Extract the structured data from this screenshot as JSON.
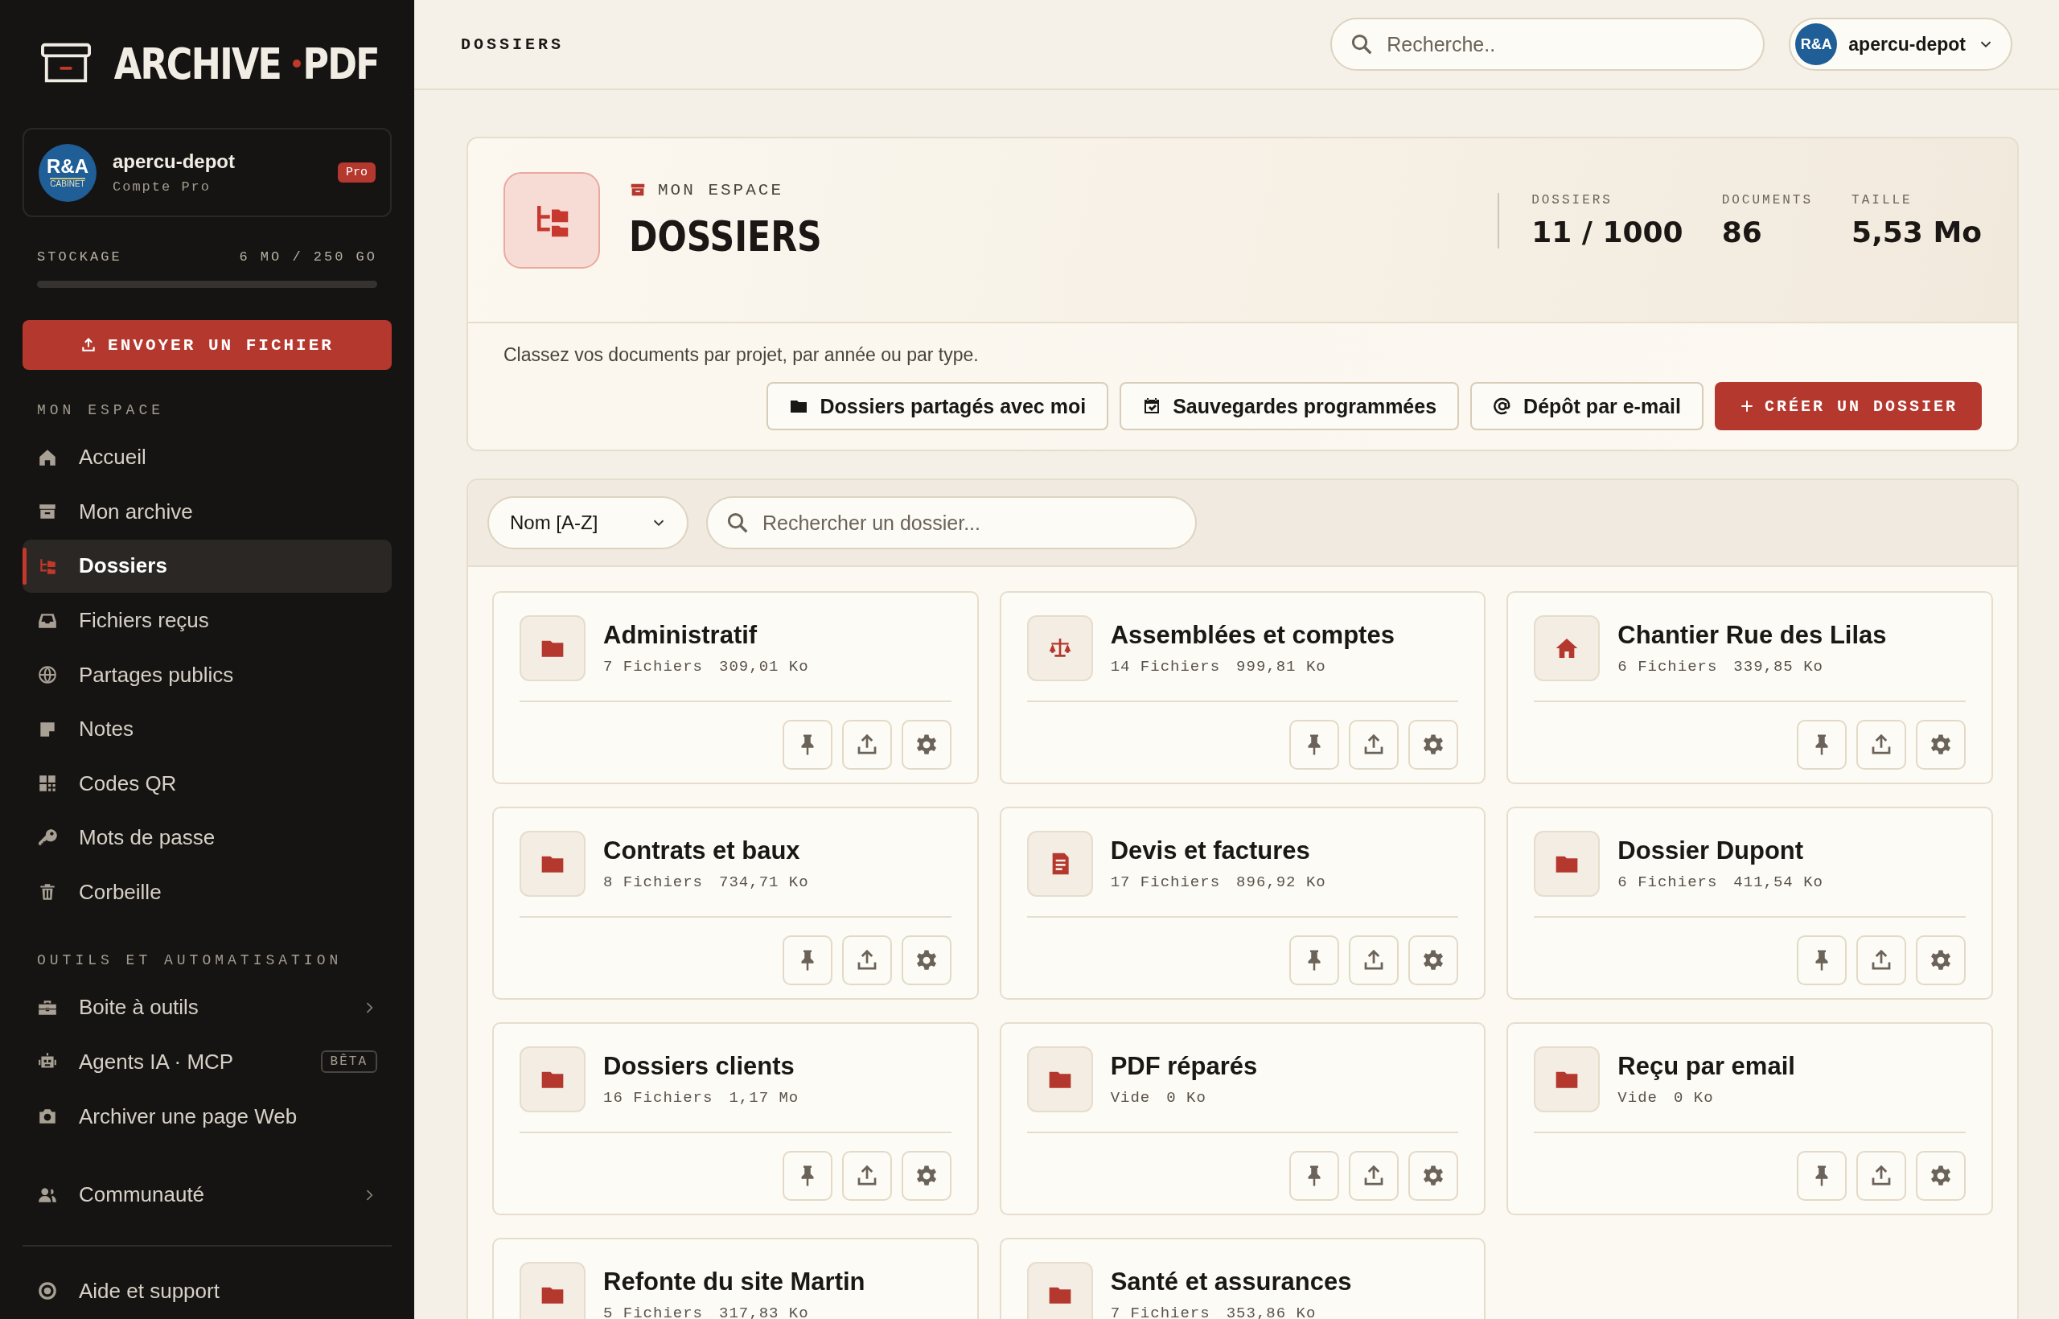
{
  "logo": {
    "left": "ARCHIVE",
    "right": "PDF"
  },
  "account": {
    "avatar": "R&A",
    "avatar_sub": "CABINET",
    "name": "apercu-depot",
    "plan": "Compte Pro",
    "badge": "Pro"
  },
  "storage": {
    "label": "STOCKAGE",
    "reading": "6 MO / 250 GO",
    "level": 0.0
  },
  "upload_button": "ENVOYER UN FICHIER",
  "nav_sections": [
    {
      "title": "MON ESPACE",
      "items": [
        {
          "label": "Accueil",
          "selected": false,
          "has_submenu": false
        },
        {
          "label": "Mon archive",
          "selected": false,
          "has_submenu": false
        },
        {
          "label": "Dossiers",
          "selected": true,
          "has_submenu": false
        },
        {
          "label": "Fichiers reçus",
          "selected": false,
          "has_submenu": false
        },
        {
          "label": "Partages publics",
          "selected": false,
          "has_submenu": false
        },
        {
          "label": "Notes",
          "selected": false,
          "has_submenu": false
        },
        {
          "label": "Codes QR",
          "selected": false,
          "has_submenu": false
        },
        {
          "label": "Mots de passe",
          "selected": false,
          "has_submenu": false
        },
        {
          "label": "Corbeille",
          "selected": false,
          "has_submenu": false
        }
      ]
    },
    {
      "title": "OUTILS ET AUTOMATISATION",
      "items": [
        {
          "label": "Boite à outils",
          "selected": false,
          "has_submenu": true
        },
        {
          "label": "Agents IA · MCP",
          "selected": false,
          "has_submenu": false,
          "badge": "BÊTA"
        },
        {
          "label": "Archiver une page Web",
          "selected": false,
          "has_submenu": false
        }
      ]
    }
  ],
  "community": {
    "label": "Communauté",
    "selected": false,
    "has_submenu": true
  },
  "help": {
    "label": "Aide et support",
    "selected": false
  },
  "topbar": {
    "title": "DOSSIERS",
    "search_placeholder": "Recherche..",
    "user": {
      "avatar": "R&A",
      "name": "apercu-depot"
    }
  },
  "hero": {
    "eyebrow": "MON ESPACE",
    "title": "DOSSIERS",
    "stats": [
      {
        "label": "DOSSIERS",
        "value": "11 / 1000"
      },
      {
        "label": "DOCUMENTS",
        "value": "86"
      },
      {
        "label": "TAILLE",
        "value": "5,53 Mo"
      }
    ],
    "description": "Classez vos documents par projet, par année ou par type.",
    "actions": [
      "Dossiers partagés avec moi",
      "Sauvegardes programmées",
      "Dépôt par e-mail"
    ],
    "create_button": "CRÉER UN DOSSIER"
  },
  "filters": {
    "sort": "Nom [A-Z]",
    "search_placeholder": "Rechercher un dossier..."
  },
  "folders": [
    {
      "name": "Administratif",
      "count": "7 Fichiers",
      "size": "309,01 Ko"
    },
    {
      "name": "Assemblées et comptes",
      "count": "14 Fichiers",
      "size": "999,81 Ko"
    },
    {
      "name": "Chantier Rue des Lilas",
      "count": "6 Fichiers",
      "size": "339,85 Ko"
    },
    {
      "name": "Contrats et baux",
      "count": "8 Fichiers",
      "size": "734,71 Ko"
    },
    {
      "name": "Devis et factures",
      "count": "17 Fichiers",
      "size": "896,92 Ko"
    },
    {
      "name": "Dossier Dupont",
      "count": "6 Fichiers",
      "size": "411,54 Ko"
    },
    {
      "name": "Dossiers clients",
      "count": "16 Fichiers",
      "size": "1,17 Mo"
    },
    {
      "name": "PDF réparés",
      "count": "Vide",
      "size": "0 Ko"
    },
    {
      "name": "Reçu par email",
      "count": "Vide",
      "size": "0 Ko"
    },
    {
      "name": "Refonte du site Martin",
      "count": "5 Fichiers",
      "size": "317,83 Ko"
    },
    {
      "name": "Santé et assurances",
      "count": "7 Fichiers",
      "size": "353,86 Ko"
    }
  ]
}
